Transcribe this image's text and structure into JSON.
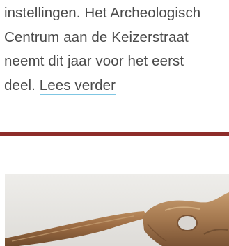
{
  "article": {
    "lines": [
      "instellingen. Het Archeologisch",
      "Centrum aan de Keizerstraat",
      "neemt dit jaar voor het eerst"
    ],
    "last_line_prefix": "deel. ",
    "read_more_label": "Lees verder"
  },
  "colors": {
    "text": "#4a4a4a",
    "link_underline": "#7fc6e3",
    "divider": "#8e2d2a"
  },
  "image": {
    "subject": "archaeological-bone-fragment"
  }
}
